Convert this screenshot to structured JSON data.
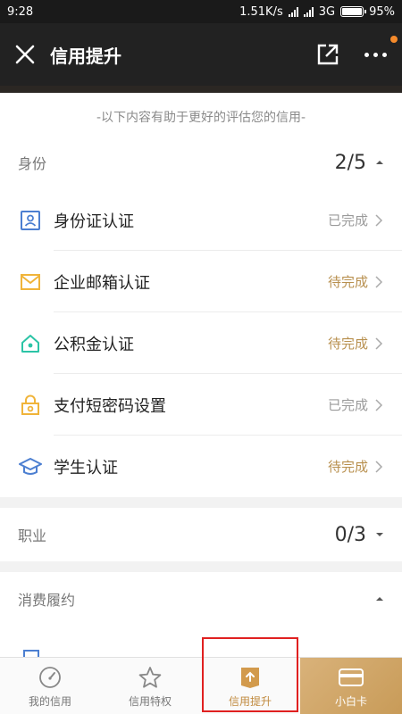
{
  "status_bar": {
    "time": "9:28",
    "speed": "1.51K/s",
    "network": "3G",
    "battery": "95%"
  },
  "nav": {
    "title": "信用提升"
  },
  "hint": "-以下内容有助于更好的评估您的信用-",
  "identity": {
    "label": "身份",
    "count": "2/5",
    "items": [
      {
        "name": "身份证认证",
        "status": "已完成",
        "state": "done",
        "icon": "id-card-icon"
      },
      {
        "name": "企业邮箱认证",
        "status": "待完成",
        "state": "pending",
        "icon": "mail-icon"
      },
      {
        "name": "公积金认证",
        "status": "待完成",
        "state": "pending",
        "icon": "house-icon"
      },
      {
        "name": "支付短密码设置",
        "status": "已完成",
        "state": "done",
        "icon": "lock-icon"
      },
      {
        "name": "学生认证",
        "status": "待完成",
        "state": "pending",
        "icon": "graduation-cap-icon"
      }
    ]
  },
  "job": {
    "label": "职业",
    "count": "0/3"
  },
  "consumption": {
    "label": "消费履约"
  },
  "tabs": [
    {
      "label": "我的信用",
      "icon": "gauge-icon"
    },
    {
      "label": "信用特权",
      "icon": "star-icon"
    },
    {
      "label": "信用提升",
      "icon": "upload-icon"
    },
    {
      "label": "小白卡",
      "icon": "card-icon"
    }
  ],
  "colors": {
    "accent": "#c08a3e",
    "pending": "#b8904f",
    "nav_bg": "#222222"
  }
}
